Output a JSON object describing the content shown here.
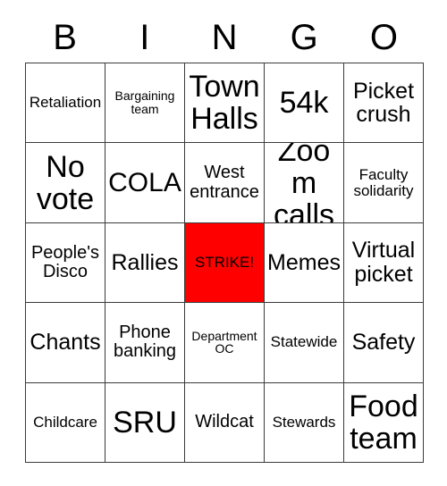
{
  "header": {
    "letters": [
      "B",
      "I",
      "N",
      "G",
      "O"
    ]
  },
  "colors": {
    "marked_background": "#ff0000",
    "cell_background": "#ffffff",
    "text": "#000000",
    "border": "#3b3b3b"
  },
  "grid": {
    "rows": 5,
    "columns": 5,
    "cells": [
      {
        "label": "Retaliation",
        "size": "fs-sm",
        "marked": false
      },
      {
        "label": "Bargaining team",
        "size": "fs-xs",
        "marked": false
      },
      {
        "label": "Town Halls",
        "size": "fs-xxl",
        "marked": false
      },
      {
        "label": "54k",
        "size": "fs-xxl",
        "marked": false
      },
      {
        "label": "Picket crush",
        "size": "fs-lg",
        "marked": false
      },
      {
        "label": "No vote",
        "size": "fs-xxl",
        "marked": false
      },
      {
        "label": "COLA",
        "size": "fs-xl",
        "marked": false
      },
      {
        "label": "West entrance",
        "size": "fs-md",
        "marked": false
      },
      {
        "label": "Zoom calls",
        "size": "fs-xxl",
        "marked": false
      },
      {
        "label": "Faculty solidarity",
        "size": "fs-sm",
        "marked": false
      },
      {
        "label": "People's Disco",
        "size": "fs-md",
        "marked": false
      },
      {
        "label": "Rallies",
        "size": "fs-lg",
        "marked": false
      },
      {
        "label": "STRIKE!",
        "size": "fs-sm",
        "marked": true
      },
      {
        "label": "Memes",
        "size": "fs-lg",
        "marked": false
      },
      {
        "label": "Virtual picket",
        "size": "fs-lg",
        "marked": false
      },
      {
        "label": "Chants",
        "size": "fs-lg",
        "marked": false
      },
      {
        "label": "Phone banking",
        "size": "fs-md",
        "marked": false
      },
      {
        "label": "Department OC",
        "size": "fs-xs",
        "marked": false
      },
      {
        "label": "Statewide",
        "size": "fs-sm",
        "marked": false
      },
      {
        "label": "Safety",
        "size": "fs-lg",
        "marked": false
      },
      {
        "label": "Childcare",
        "size": "fs-sm",
        "marked": false
      },
      {
        "label": "SRU",
        "size": "fs-xxl",
        "marked": false
      },
      {
        "label": "Wildcat",
        "size": "fs-md",
        "marked": false
      },
      {
        "label": "Stewards",
        "size": "fs-sm",
        "marked": false
      },
      {
        "label": "Food team",
        "size": "fs-xxl",
        "marked": false
      }
    ]
  }
}
